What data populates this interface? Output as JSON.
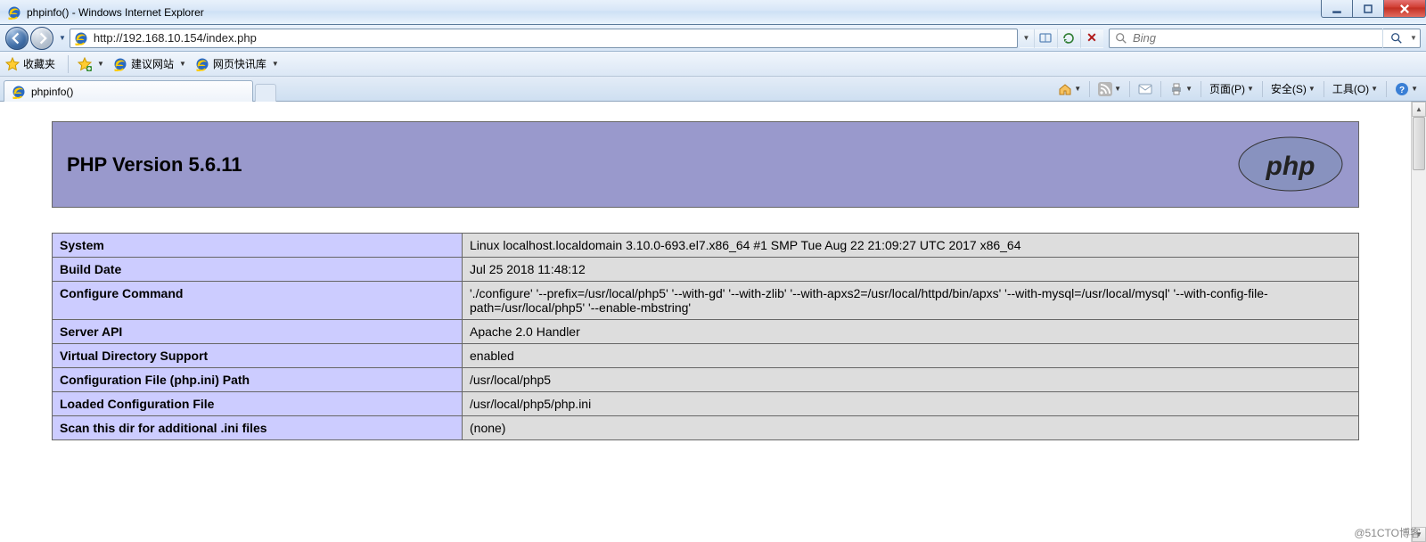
{
  "window": {
    "title": "phpinfo() - Windows Internet Explorer"
  },
  "nav": {
    "url": "http://192.168.10.154/index.php",
    "search_placeholder": "Bing"
  },
  "favrow": {
    "label": "收藏夹",
    "links": [
      {
        "label": "建议网站"
      },
      {
        "label": "网页快讯库"
      }
    ]
  },
  "tab": {
    "title": "phpinfo()"
  },
  "toolbar": {
    "page": "页面(P)",
    "safety": "安全(S)",
    "tools": "工具(O)"
  },
  "php": {
    "version_title": "PHP Version 5.6.11",
    "rows": [
      {
        "k": "System",
        "v": "Linux localhost.localdomain 3.10.0-693.el7.x86_64 #1 SMP Tue Aug 22 21:09:27 UTC 2017 x86_64"
      },
      {
        "k": "Build Date",
        "v": "Jul 25 2018 11:48:12"
      },
      {
        "k": "Configure Command",
        "v": "'./configure' '--prefix=/usr/local/php5' '--with-gd' '--with-zlib' '--with-apxs2=/usr/local/httpd/bin/apxs' '--with-mysql=/usr/local/mysql' '--with-config-file-path=/usr/local/php5' '--enable-mbstring'"
      },
      {
        "k": "Server API",
        "v": "Apache 2.0 Handler"
      },
      {
        "k": "Virtual Directory Support",
        "v": "enabled"
      },
      {
        "k": "Configuration File (php.ini) Path",
        "v": "/usr/local/php5"
      },
      {
        "k": "Loaded Configuration File",
        "v": "/usr/local/php5/php.ini"
      },
      {
        "k": "Scan this dir for additional .ini files",
        "v": "(none)"
      }
    ]
  },
  "watermark": "@51CTO博客"
}
